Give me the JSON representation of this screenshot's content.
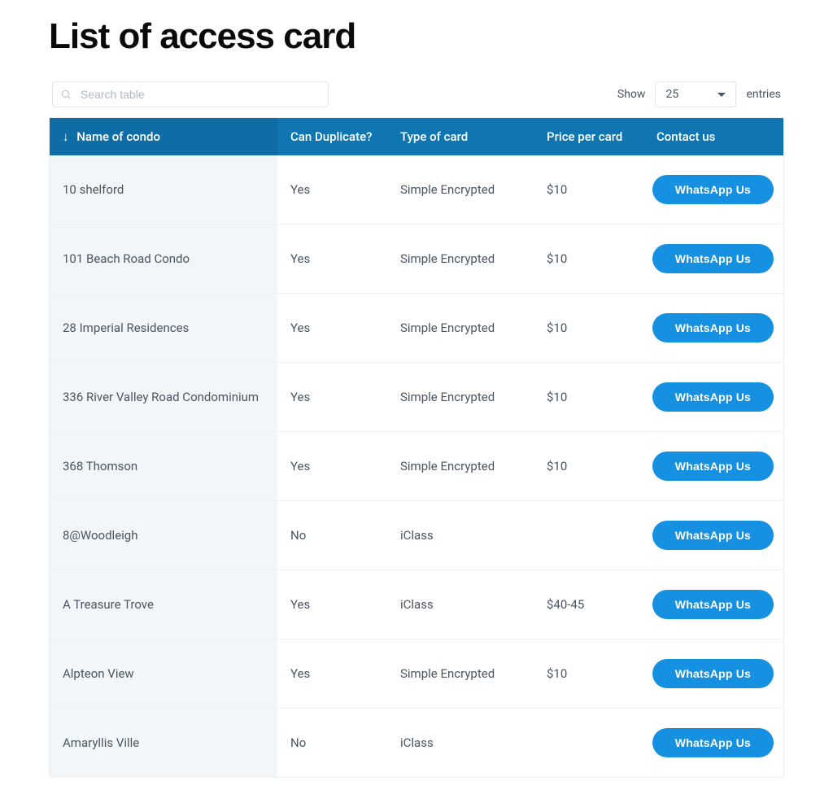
{
  "title": "List of access card",
  "search": {
    "placeholder": "Search table"
  },
  "entries": {
    "show_label": "Show",
    "selected": "25",
    "entries_label": "entries"
  },
  "columns": {
    "name": "Name of condo",
    "dup": "Can Duplicate?",
    "type": "Type of card",
    "price": "Price per card",
    "contact": "Contact us"
  },
  "button_label": "WhatsApp Us",
  "rows": [
    {
      "name": "10 shelford",
      "dup": "Yes",
      "type": "Simple Encrypted",
      "price": "$10"
    },
    {
      "name": "101 Beach Road Condo",
      "dup": "Yes",
      "type": "Simple Encrypted",
      "price": "$10"
    },
    {
      "name": "28 Imperial Residences",
      "dup": "Yes",
      "type": "Simple Encrypted",
      "price": "$10"
    },
    {
      "name": "336 River Valley Road Condominium",
      "dup": "Yes",
      "type": "Simple Encrypted",
      "price": "$10"
    },
    {
      "name": "368 Thomson",
      "dup": "Yes",
      "type": "Simple Encrypted",
      "price": "$10"
    },
    {
      "name": "8@Woodleigh",
      "dup": "No",
      "type": "iClass",
      "price": ""
    },
    {
      "name": "A Treasure Trove",
      "dup": "Yes",
      "type": "iClass",
      "price": "$40-45"
    },
    {
      "name": "Alpteon View",
      "dup": "Yes",
      "type": "Simple Encrypted",
      "price": "$10"
    },
    {
      "name": "Amaryllis Ville",
      "dup": "No",
      "type": "iClass",
      "price": ""
    }
  ]
}
